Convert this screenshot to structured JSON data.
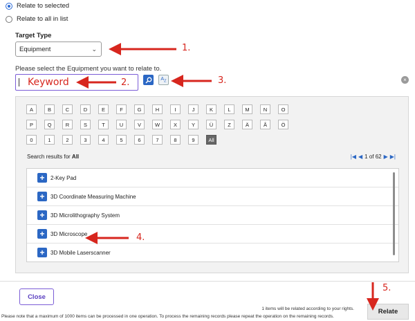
{
  "relate_options": [
    {
      "label": "Relate to selected",
      "checked": true
    },
    {
      "label": "Relate to all in list",
      "checked": false
    }
  ],
  "target_type": {
    "label": "Target Type",
    "value": "Equipment"
  },
  "search": {
    "hint": "Please select the Equipment you want to relate to.",
    "value": "Keyword"
  },
  "alphabet_rows": [
    [
      "A",
      "B",
      "C",
      "D",
      "E",
      "F",
      "G",
      "H",
      "I",
      "J",
      "K",
      "L",
      "M",
      "N",
      "O"
    ],
    [
      "P",
      "Q",
      "R",
      "S",
      "T",
      "U",
      "V",
      "W",
      "X",
      "Y",
      "Ü",
      "Z",
      "Ä",
      "Å",
      "Ö"
    ],
    [
      "0",
      "1",
      "2",
      "3",
      "4",
      "5",
      "6",
      "7",
      "8",
      "9",
      "All"
    ]
  ],
  "results": {
    "label_prefix": "Search results for ",
    "label_filter": "All",
    "pager_text": "1 of 62",
    "items": [
      "2-Key Pad",
      "3D Coordinate Measuring Machine",
      "3D Microlithography System",
      "3D Microscope",
      "3D Mobile Laserscanner"
    ]
  },
  "footer": {
    "close_label": "Close",
    "info_line1": "1 items will be related according to your rights.",
    "info_line2": "Please note that a maximum of 1000 items can be processed in one operation. To process the remaining records please repeat the operation on the remaining records.",
    "relate_label": "Relate"
  },
  "annotations": [
    "1.",
    "2.",
    "3.",
    "4.",
    "5."
  ],
  "colors": {
    "accent": "#2b67c4",
    "annotation": "#d7261e",
    "outline": "#7b5cd6"
  }
}
